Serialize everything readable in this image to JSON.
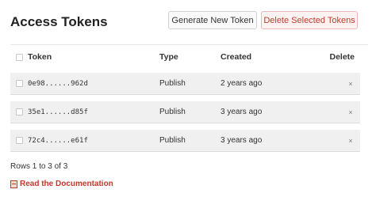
{
  "header": {
    "title": "Access Tokens",
    "generate_label": "Generate New Token",
    "delete_selected_label": "Delete Selected Tokens"
  },
  "table": {
    "columns": {
      "token": "Token",
      "type": "Type",
      "created": "Created",
      "delete": "Delete"
    },
    "rows": [
      {
        "token": "0e98......962d",
        "type": "Publish",
        "created": "2 years ago",
        "delete_icon": "×"
      },
      {
        "token": "35e1......d85f",
        "type": "Publish",
        "created": "3 years ago",
        "delete_icon": "×"
      },
      {
        "token": "72c4......e61f",
        "type": "Publish",
        "created": "3 years ago",
        "delete_icon": "×"
      }
    ]
  },
  "footer": {
    "rows_summary": "Rows 1 to 3 of 3",
    "doc_link": "Read the Documentation"
  },
  "colors": {
    "accent_red": "#c0392b",
    "row_bg": "#f0f0f0"
  }
}
